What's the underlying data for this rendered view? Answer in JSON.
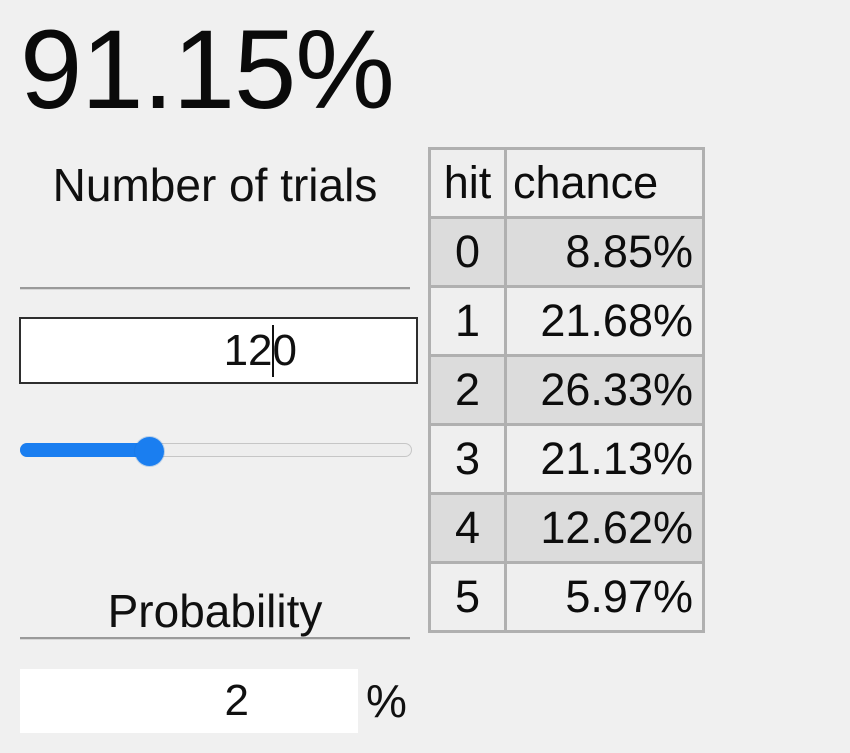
{
  "result": {
    "value": "91.15%"
  },
  "trials": {
    "label": "Number of trials",
    "input_value": "12",
    "input_value_after_caret": "0",
    "full_value": "120",
    "slider": {
      "fill_percent": 33,
      "accent_color": "#1a7ef0",
      "track_color": "#eeeeee"
    }
  },
  "probability": {
    "label": "Probability",
    "input_value": "2",
    "unit_suffix": "%"
  },
  "table": {
    "headers": [
      "hit",
      "chance"
    ],
    "rows": [
      {
        "hit": "0",
        "chance": "8.85%"
      },
      {
        "hit": "1",
        "chance": "21.68%"
      },
      {
        "hit": "2",
        "chance": "26.33%"
      },
      {
        "hit": "3",
        "chance": "21.13%"
      },
      {
        "hit": "4",
        "chance": "12.62%"
      },
      {
        "hit": "5",
        "chance": "5.97%"
      }
    ]
  },
  "theme": {
    "background": "#f0f0f0",
    "text": "#0c0c0c",
    "border": "#b0b0b0",
    "row_dark": "#dcdcdc",
    "row_light": "#efefef"
  },
  "chart_data": {
    "type": "table",
    "title": "Binomial hit distribution",
    "categories": [
      "0",
      "1",
      "2",
      "3",
      "4",
      "5"
    ],
    "values": [
      8.85,
      21.68,
      26.33,
      21.13,
      12.62,
      5.97
    ],
    "xlabel": "hit",
    "ylabel": "chance",
    "annotations": [
      "91.15%"
    ],
    "ylim": [
      0,
      100
    ]
  }
}
